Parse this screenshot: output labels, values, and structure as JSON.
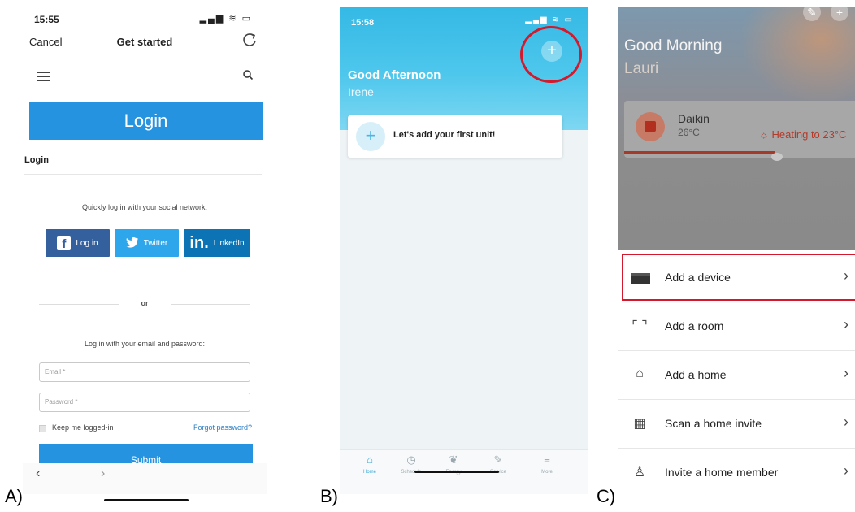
{
  "panel_labels": {
    "a": "A)",
    "b": "B)",
    "c": "C)"
  },
  "panel_a": {
    "status_time": "15:55",
    "status_icons": "▂▄▆ ≋ ▭",
    "cancel": "Cancel",
    "title": "Get started",
    "banner": "Login",
    "subhead": "Login",
    "social_caption": "Quickly log in with your social network:",
    "facebook_label": "Log in",
    "twitter_label": "Twitter",
    "linkedin_label": "LinkedIn",
    "or": "or",
    "email_caption": "Log in with your email and password:",
    "email_placeholder": "Email *",
    "password_placeholder": "Password *",
    "keep_logged": "Keep me logged-in",
    "forgot": "Forgot password?",
    "submit": "Submit"
  },
  "panel_b": {
    "status_time": "15:58",
    "status_icons": "▂▄▆ ≋ ▭",
    "greeting": "Good Afternoon",
    "user": "Irene",
    "card_text": "Let's add your first unit!",
    "tabs": [
      {
        "label": "Home",
        "icon": "⌂"
      },
      {
        "label": "Schedule",
        "icon": "◷"
      },
      {
        "label": "Energy",
        "icon": "❦"
      },
      {
        "label": "Service",
        "icon": "✎"
      },
      {
        "label": "More",
        "icon": "≡"
      }
    ]
  },
  "panel_c": {
    "greeting": "Good Morning",
    "user": "Lauri",
    "device_name": "Daikin",
    "device_temp": "26°C",
    "heating": "☼ Heating to 23°C",
    "menu": [
      {
        "label": "Add a device",
        "icon": "tablet-icon"
      },
      {
        "label": "Add a room",
        "icon": "room-bracket-icon",
        "glyph": "⌜ ⌝"
      },
      {
        "label": "Add a home",
        "icon": "home-icon",
        "glyph": "⌂"
      },
      {
        "label": "Scan a home invite",
        "icon": "qr-scan-icon",
        "glyph": "▦"
      },
      {
        "label": "Invite a home member",
        "icon": "add-person-icon",
        "glyph": "♙"
      }
    ],
    "chevron": "›"
  },
  "colors": {
    "login_blue": "#2593e0",
    "facebook": "#35609e",
    "twitter": "#2ea6ec",
    "linkedin": "#0c74b4",
    "daikin_cyan": "#34b9e5",
    "highlight_red": "#d3192b"
  }
}
